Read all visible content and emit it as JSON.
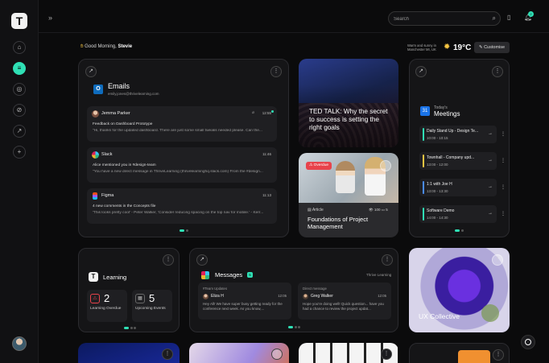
{
  "header": {
    "search_placeholder": "Search",
    "greeting_prefix": "Good Morning,",
    "user_name": "Stevie",
    "weather_text": "Warm and sunny in Manchester MI, UK",
    "temperature": "19°C",
    "customise_label": "Customise",
    "notification_count": "2"
  },
  "emails": {
    "title": "Emails",
    "account": "emily.jones@thrivelearning.com",
    "items": [
      {
        "sender": "Jemma Parker",
        "time": "12:55",
        "subject": "Feedback on Dashboard Prototype",
        "preview": "\"Hi, thanks for the updated dashboard. There are just some small tweaks needed please. Can the..."
      },
      {
        "sender": "Slack",
        "time": "11:46",
        "subject": "Alice mentioned you in #design-team",
        "preview": "\"You have a new direct message in ThriveLearning (thrivelearninghq.slack.com) From the #design..."
      },
      {
        "sender": "Figma",
        "time": "11:13",
        "subject": "4 new comments in the Concepts file",
        "preview": "'This looks pretty cool' - Peter Walker, 'Consider reducing spacing on the top nav for mobile.' - Kerr..."
      }
    ]
  },
  "ted": {
    "title": "TED TALK: Why the secret to success is setting the right goals"
  },
  "article": {
    "badge": "Overdue",
    "type": "Article",
    "views": "100",
    "comments": "5",
    "title": "Foundations of Project Management"
  },
  "meetings": {
    "label": "Today's",
    "title": "Meetings",
    "items": [
      {
        "title": "Daily Stand Up - Design Te...",
        "time": "10:00 - 10:15",
        "color": "#2fe0b5"
      },
      {
        "title": "Townhall - Company upd...",
        "time": "13:00 - 12:00",
        "color": "#f5c542"
      },
      {
        "title": "1:1 with Joe H",
        "time": "13:00 - 13:30",
        "color": "#4a8cff"
      },
      {
        "title": "Software Demo",
        "time": "14:00 - 14:30",
        "color": "#2fe0b5"
      }
    ]
  },
  "learning": {
    "title": "Learning",
    "stats": [
      {
        "value": "2",
        "label": "Learning Overdue"
      },
      {
        "value": "5",
        "label": "Upcoming Events"
      }
    ]
  },
  "messages": {
    "title": "Messages",
    "badge": "5",
    "workspace": "Thrive Learning",
    "items": [
      {
        "channel": "#Team Updates",
        "sender": "Eliza H",
        "time": "12:05",
        "text": "Hey All! We have super busy getting ready for the conference next week. As you know,..."
      },
      {
        "channel": "Direct message",
        "sender": "Greg Walker",
        "time": "12:05",
        "text": "Hope you're doing well! Quick question... have you had a chance to review the project updat..."
      }
    ]
  },
  "ux": {
    "title": "UX Collective"
  },
  "colors": {
    "accent": "#2fe0b5",
    "overdue": "#e8434b"
  }
}
